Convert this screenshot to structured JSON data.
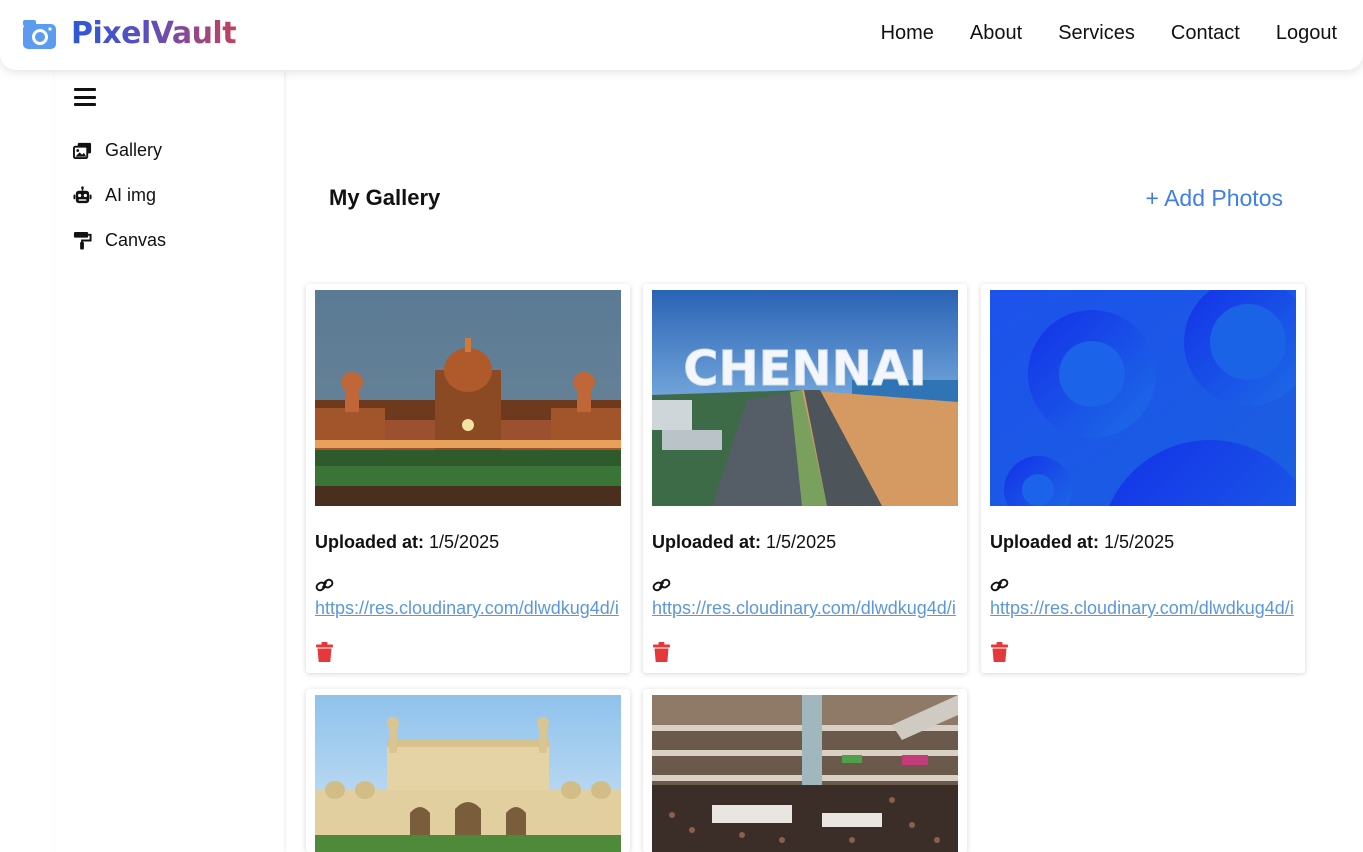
{
  "header": {
    "brand": "PixelVault",
    "brand_icon": "camera-icon",
    "nav": [
      "Home",
      "About",
      "Services",
      "Contact",
      "Logout"
    ]
  },
  "sidebar": {
    "menu_icon": "hamburger-icon",
    "items": [
      {
        "label": "Gallery",
        "icon": "images-icon"
      },
      {
        "label": "AI img",
        "icon": "robot-icon"
      },
      {
        "label": "Canvas",
        "icon": "paint-roller-icon"
      }
    ]
  },
  "main": {
    "title": "My Gallery",
    "add_button": "+ Add Photos"
  },
  "gallery": {
    "uploaded_label": "Uploaded at:",
    "cards": [
      {
        "image": "illuminated-heritage-building",
        "date": "1/5/2025",
        "url": "https://res.cloudinary.com/dlwdkug4d/i"
      },
      {
        "image": "chennai-aerial-beach",
        "date": "1/5/2025",
        "url": "https://res.cloudinary.com/dlwdkug4d/i"
      },
      {
        "image": "blue-circles-abstract",
        "date": "1/5/2025",
        "url": "https://res.cloudinary.com/dlwdkug4d/i"
      },
      {
        "image": "imambara-palace",
        "date": "",
        "url": ""
      },
      {
        "image": "crowded-mall-interior",
        "date": "",
        "url": ""
      }
    ],
    "chennai_text": "CHENNAI"
  },
  "colors": {
    "accent": "#3f7fe6",
    "link": "#5b97e0",
    "delete": "#e5383b",
    "brand_start": "#2b5ad6",
    "brand_end": "#c4415a"
  }
}
